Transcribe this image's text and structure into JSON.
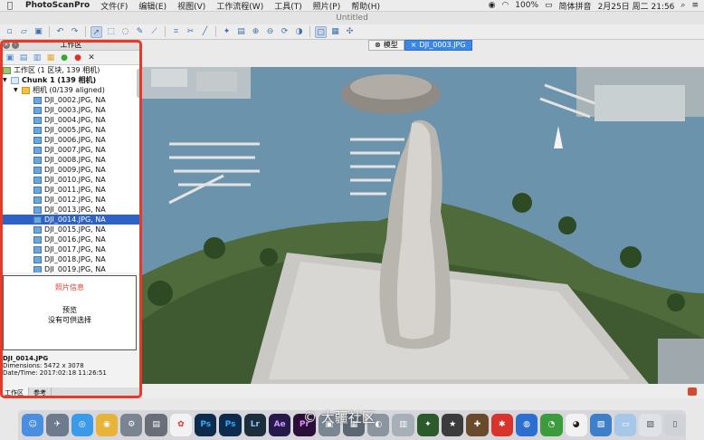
{
  "menubar": {
    "app": "PhotoScanPro",
    "items": [
      "文件(F)",
      "编辑(E)",
      "视图(V)",
      "工作流程(W)",
      "工具(T)",
      "照片(P)",
      "帮助(H)"
    ],
    "battery": "100%",
    "input_method": "简体拼音",
    "datetime": "2月25日 周二 21:56"
  },
  "window": {
    "title": "Untitled"
  },
  "workspace": {
    "header": "工作区",
    "root_label": "工作区 (1 区块, 139 相机)",
    "chunk_label": "Chunk 1 (139 相机)",
    "cameras_label": "相机 (0/139 aligned)",
    "images": [
      "DJI_0002.JPG, NA",
      "DJI_0003.JPG, NA",
      "DJI_0004.JPG, NA",
      "DJI_0005.JPG, NA",
      "DJI_0006.JPG, NA",
      "DJI_0007.JPG, NA",
      "DJI_0008.JPG, NA",
      "DJI_0009.JPG, NA",
      "DJI_0010.JPG, NA",
      "DJI_0011.JPG, NA",
      "DJI_0012.JPG, NA",
      "DJI_0013.JPG, NA",
      "DJI_0014.JPG, NA",
      "DJI_0015.JPG, NA",
      "DJI_0016.JPG, NA",
      "DJI_0017.JPG, NA",
      "DJI_0018.JPG, NA",
      "DJI_0019.JPG, NA"
    ],
    "selected_image": "DJI_0014.JPG, NA"
  },
  "photo_info": {
    "title": "照片信息",
    "preview": "预览",
    "preview_msg": "没有可供选择",
    "filename": "DJI_0014.JPG",
    "dimensions": "Dimensions: 5472 x 3078",
    "datetime": "Date/Time: 2017:02:18 11:26:51"
  },
  "panel_tabs": [
    "工作区",
    "参考"
  ],
  "view_tabs": {
    "model": "模型",
    "photo": "DJI_0003.JPG"
  },
  "watermark": "© 大疆社区"
}
